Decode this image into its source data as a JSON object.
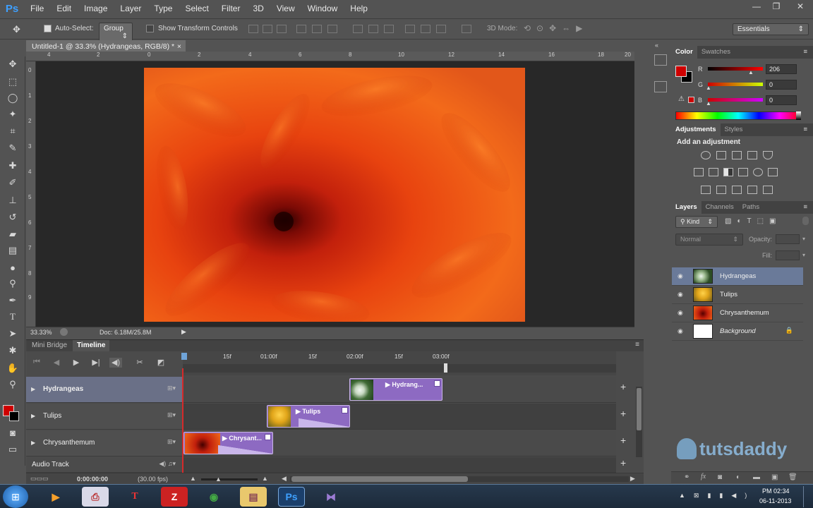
{
  "app": {
    "logo": "Ps"
  },
  "menu": [
    "File",
    "Edit",
    "Image",
    "Layer",
    "Type",
    "Select",
    "Filter",
    "3D",
    "View",
    "Window",
    "Help"
  ],
  "window_controls": [
    "—",
    "❐",
    "✕"
  ],
  "options": {
    "auto_select_label": "Auto-Select:",
    "auto_select_value": "Group",
    "transform_label": "Show Transform Controls",
    "mode_label": "3D Mode:",
    "workspace": "Essentials"
  },
  "document": {
    "tab_title": "Untitled-1 @ 33.3% (Hydrangeas, RGB/8) *",
    "close": "×",
    "zoom": "33.33%",
    "doc_info": "Doc: 6.18M/25.8M"
  },
  "ruler": {
    "top": [
      "4",
      "2",
      "0",
      "2",
      "4",
      "6",
      "8",
      "10",
      "12",
      "14",
      "16",
      "18",
      "20"
    ],
    "left": [
      "0",
      "1",
      "2",
      "3",
      "4",
      "5",
      "6",
      "7",
      "8",
      "9"
    ]
  },
  "timeline": {
    "tabs": [
      "Mini Bridge",
      "Timeline"
    ],
    "time_labels": [
      "15f",
      "01:00f",
      "15f",
      "02:00f",
      "15f",
      "03:00f"
    ],
    "tracks": [
      {
        "name": "Hydrangeas"
      },
      {
        "name": "Tulips"
      },
      {
        "name": "Chrysanthemum"
      }
    ],
    "clips": [
      "Hydrang...",
      "Tulips",
      "Chrysant..."
    ],
    "audio_track": "Audio Track",
    "timecode": "0:00:00:00",
    "fps": "(30.00 fps)"
  },
  "color_panel": {
    "tabs": [
      "Color",
      "Swatches"
    ],
    "channels": [
      {
        "label": "R",
        "value": "206"
      },
      {
        "label": "G",
        "value": "0"
      },
      {
        "label": "B",
        "value": "0"
      }
    ],
    "foreground": "#ce0000"
  },
  "adjustments_panel": {
    "tabs": [
      "Adjustments",
      "Styles"
    ],
    "title": "Add an adjustment"
  },
  "layers_panel": {
    "tabs": [
      "Layers",
      "Channels",
      "Paths"
    ],
    "filter": "Kind",
    "blend_mode": "Normal",
    "opacity_label": "Opacity:",
    "fill_label": "Fill:",
    "layers": [
      {
        "name": "Hydrangeas",
        "selected": true
      },
      {
        "name": "Tulips",
        "selected": false
      },
      {
        "name": "Chrysanthemum",
        "selected": false
      },
      {
        "name": "Background",
        "selected": false
      }
    ]
  },
  "watermark": "tutsdaddy",
  "taskbar": {
    "clock_time": "PM 02:34",
    "clock_date": "06-11-2013"
  }
}
